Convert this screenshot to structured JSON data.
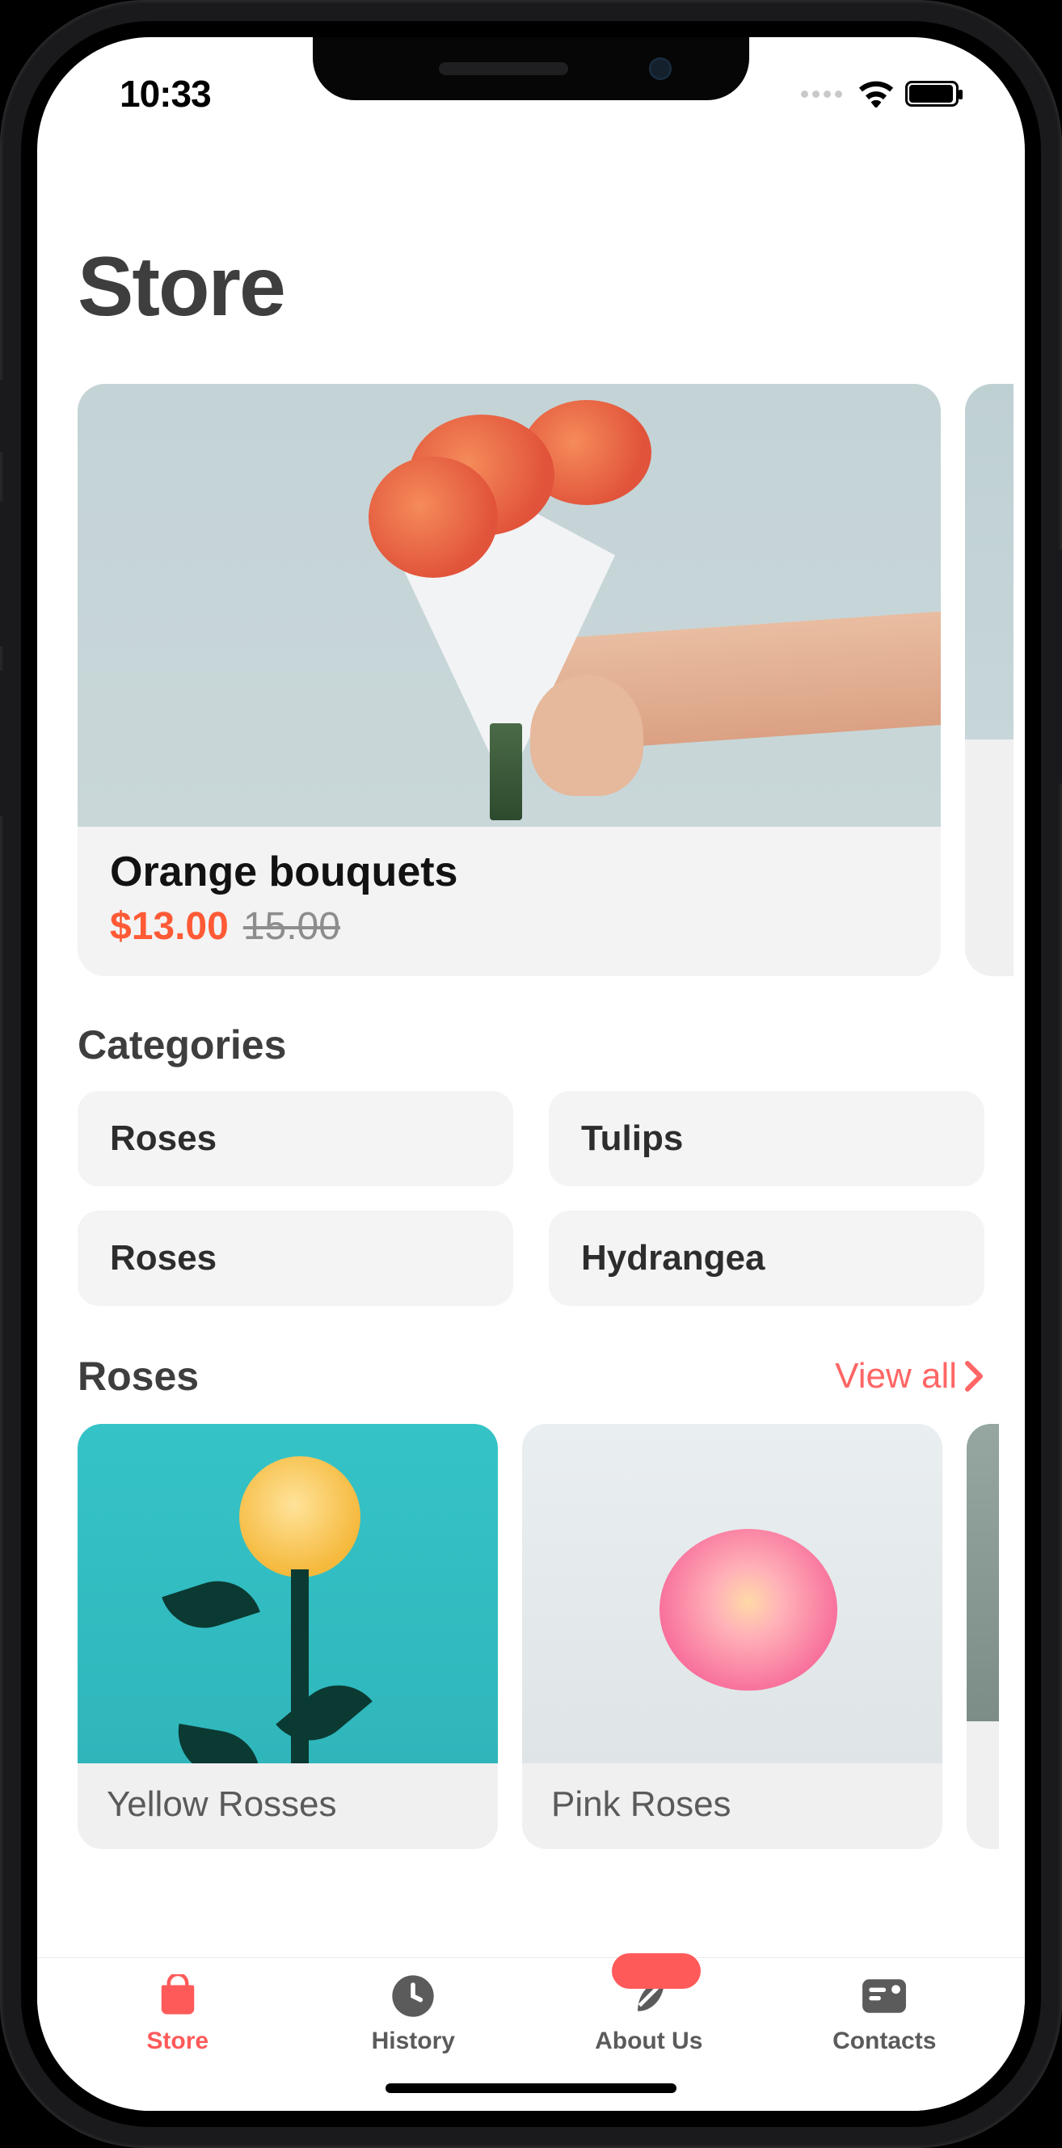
{
  "status": {
    "time": "10:33"
  },
  "page": {
    "title": "Store"
  },
  "hero": {
    "title": "Orange bouquets",
    "price": "$13.00",
    "old_price": "15.00"
  },
  "categories": {
    "title": "Categories",
    "items": [
      "Roses",
      "Tulips",
      "Roses",
      "Hydrangea"
    ]
  },
  "roses_section": {
    "title": "Roses",
    "view_all": "View all",
    "products": [
      {
        "name": "Yellow Rosses"
      },
      {
        "name": "Pink Roses"
      }
    ]
  },
  "tabs": [
    {
      "id": "store",
      "label": "Store",
      "active": true
    },
    {
      "id": "history",
      "label": "History",
      "active": false
    },
    {
      "id": "about",
      "label": "About Us",
      "active": false
    },
    {
      "id": "contacts",
      "label": "Contacts",
      "active": false
    }
  ]
}
